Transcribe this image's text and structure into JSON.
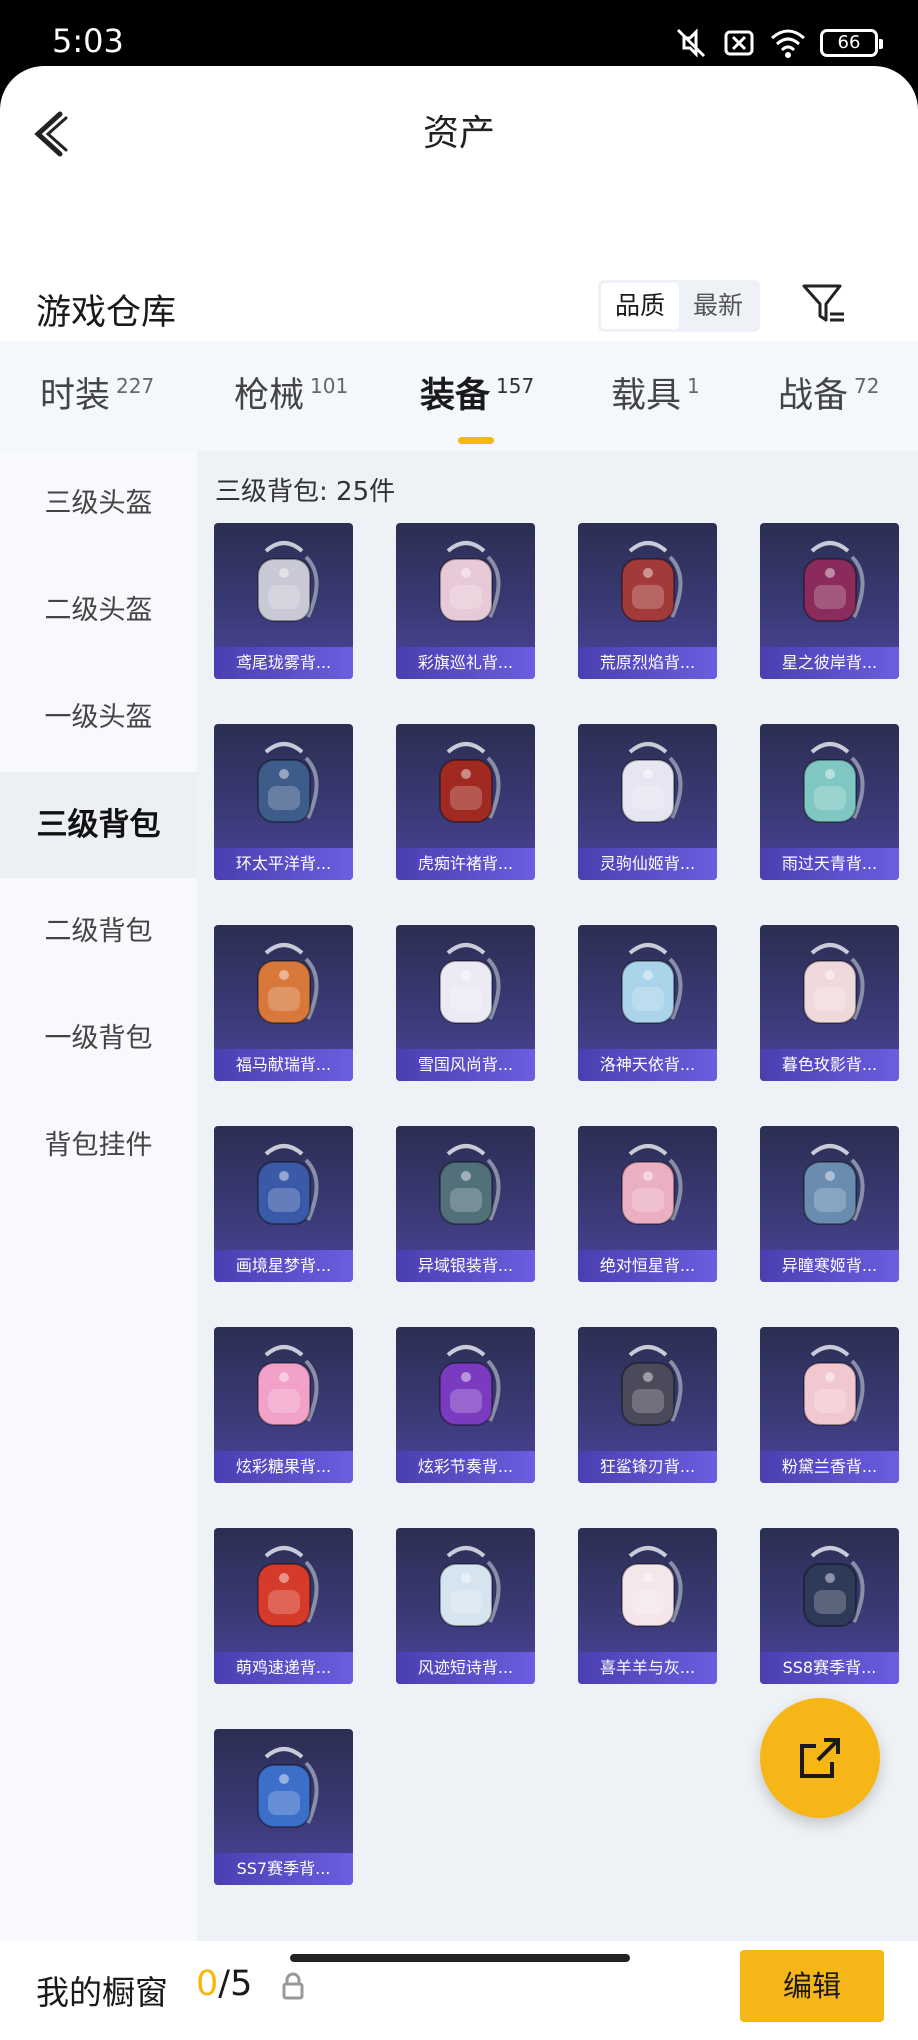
{
  "status_bar": {
    "time": "5:03",
    "battery": "66"
  },
  "header": {
    "title": "资产"
  },
  "warehouse": {
    "title": "游戏仓库",
    "sort_options": [
      "品质",
      "最新"
    ],
    "active_sort": "品质"
  },
  "tabs": [
    {
      "label": "时装",
      "count": "227"
    },
    {
      "label": "枪械",
      "count": "101"
    },
    {
      "label": "装备",
      "count": "157"
    },
    {
      "label": "载具",
      "count": "1"
    },
    {
      "label": "战备",
      "count": "72"
    }
  ],
  "active_tab": "装备",
  "sidebar": {
    "items": [
      "三级头盔",
      "二级头盔",
      "一级头盔",
      "三级背包",
      "二级背包",
      "一级背包",
      "背包挂件"
    ],
    "active": "三级背包"
  },
  "section_label": "三级背包: 25件",
  "items": [
    {
      "name": "鸢尾珑雾背...",
      "color": "#c9c9d6"
    },
    {
      "name": "彩旗巡礼背...",
      "color": "#e8c9d8"
    },
    {
      "name": "荒原烈焰背...",
      "color": "#a33a3a"
    },
    {
      "name": "星之彼岸背...",
      "color": "#8a2b5c"
    },
    {
      "name": "环太平洋背...",
      "color": "#3e5c8a"
    },
    {
      "name": "虎痴许褚背...",
      "color": "#a02a22"
    },
    {
      "name": "灵驹仙姬背...",
      "color": "#e6e6f2"
    },
    {
      "name": "雨过天青背...",
      "color": "#7fc7c2"
    },
    {
      "name": "福马献瑞背...",
      "color": "#d8783a"
    },
    {
      "name": "雪国风尚背...",
      "color": "#ecebf5"
    },
    {
      "name": "洛神天依背...",
      "color": "#a9d4ea"
    },
    {
      "name": "暮色玫影背...",
      "color": "#f0d9dc"
    },
    {
      "name": "画境星梦背...",
      "color": "#3a5aa8"
    },
    {
      "name": "异域银装背...",
      "color": "#52707a"
    },
    {
      "name": "绝对恒星背...",
      "color": "#eab0c2"
    },
    {
      "name": "异瞳寒姬背...",
      "color": "#6a8cb0"
    },
    {
      "name": "炫彩糖果背...",
      "color": "#f2a1c8"
    },
    {
      "name": "炫彩节奏背...",
      "color": "#7b3bc0"
    },
    {
      "name": "狂鲨锋刃背...",
      "color": "#4a4a5a"
    },
    {
      "name": "粉黛兰香背...",
      "color": "#f1c8cf"
    },
    {
      "name": "萌鸡速递背...",
      "color": "#d63a2a"
    },
    {
      "name": "风迹短诗背...",
      "color": "#d6e4f0"
    },
    {
      "name": "喜羊羊与灰...",
      "color": "#f4e6ea"
    },
    {
      "name": "SS8赛季背...",
      "color": "#2e3a58"
    },
    {
      "name": "SS7赛季背...",
      "color": "#3b6fc9"
    }
  ],
  "bottom_bar": {
    "label": "我的橱窗",
    "used": "0",
    "total": "/5",
    "edit": "编辑"
  },
  "colors": {
    "accent": "#f7b617",
    "card_top": "#2b2e52",
    "card_bottom": "#4d44a0"
  }
}
